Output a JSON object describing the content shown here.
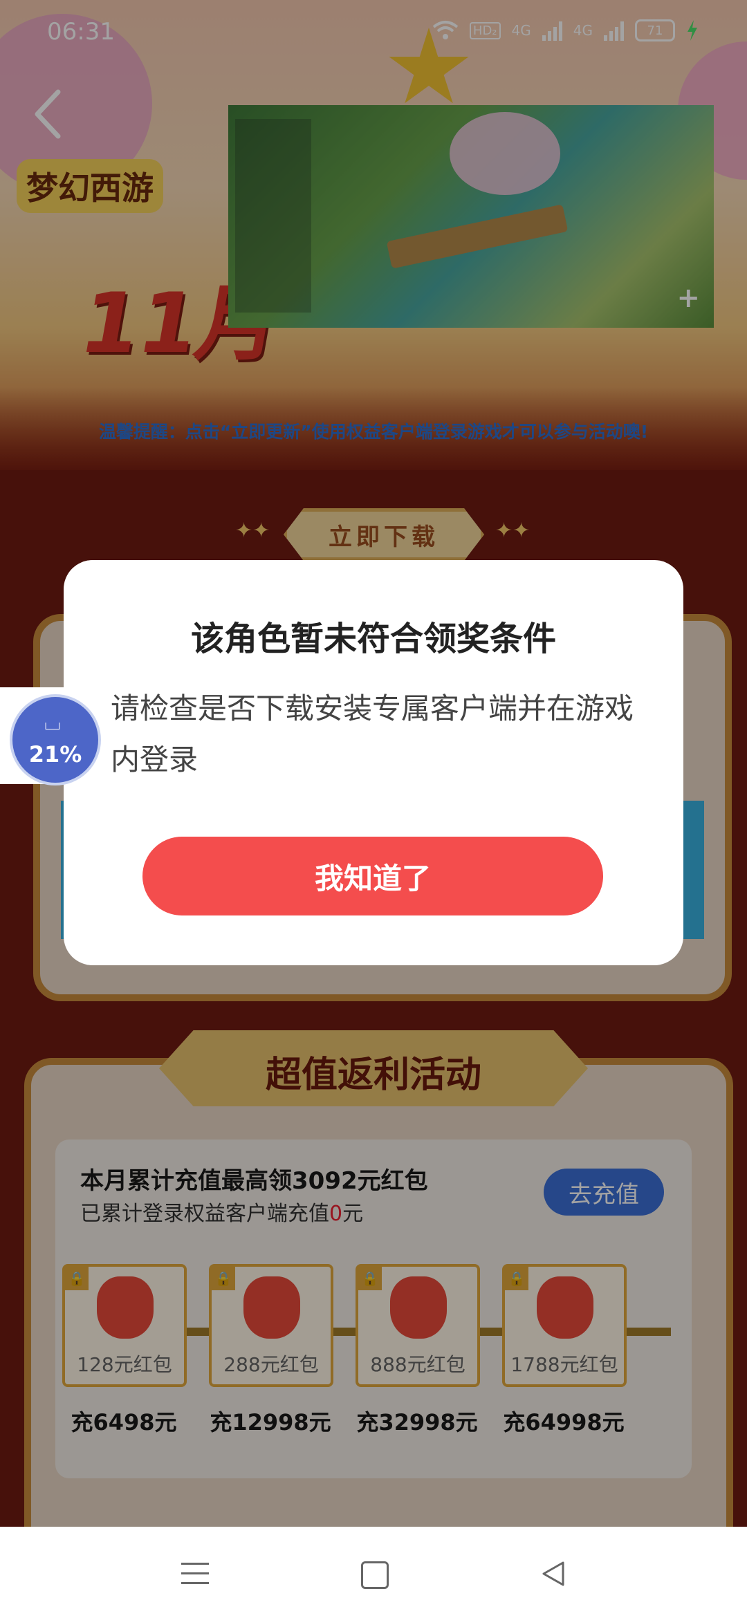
{
  "status_bar": {
    "time": "06:31",
    "hd": "HD₂",
    "net1": "4G",
    "net2": "4G",
    "battery": "71"
  },
  "banner": {
    "logo": "梦幻西游",
    "big_title": "11月",
    "notice": "温馨提醒：点击“立即更新”使用权益客户端登录游戏才可以参与活动噢!"
  },
  "download_button": "立即下载",
  "promo": {
    "section_title": "超值返利活动",
    "headline": "本月累计充值最高领3092元红包",
    "sub_prefix": "已累计登录权益客户端充值",
    "sub_amount": "0",
    "sub_suffix": "元",
    "recharge_button": "去充值",
    "tiers": [
      {
        "label": "128元红包",
        "condition": "充6498元"
      },
      {
        "label": "288元红包",
        "condition": "充12998元"
      },
      {
        "label": "888元红包",
        "condition": "充32998元"
      },
      {
        "label": "1788元红包",
        "condition": "充64998元"
      }
    ]
  },
  "dialog": {
    "title": "该角色暂未符合领奖条件",
    "message": "请检查是否下载安装专属客户端并在游戏内登录",
    "ok_button": "我知道了"
  },
  "floating_progress": {
    "percent": "21%"
  },
  "colors": {
    "accent_red": "#f44d4d",
    "link_blue": "#3c6fd6",
    "gold": "#e2a83c"
  }
}
